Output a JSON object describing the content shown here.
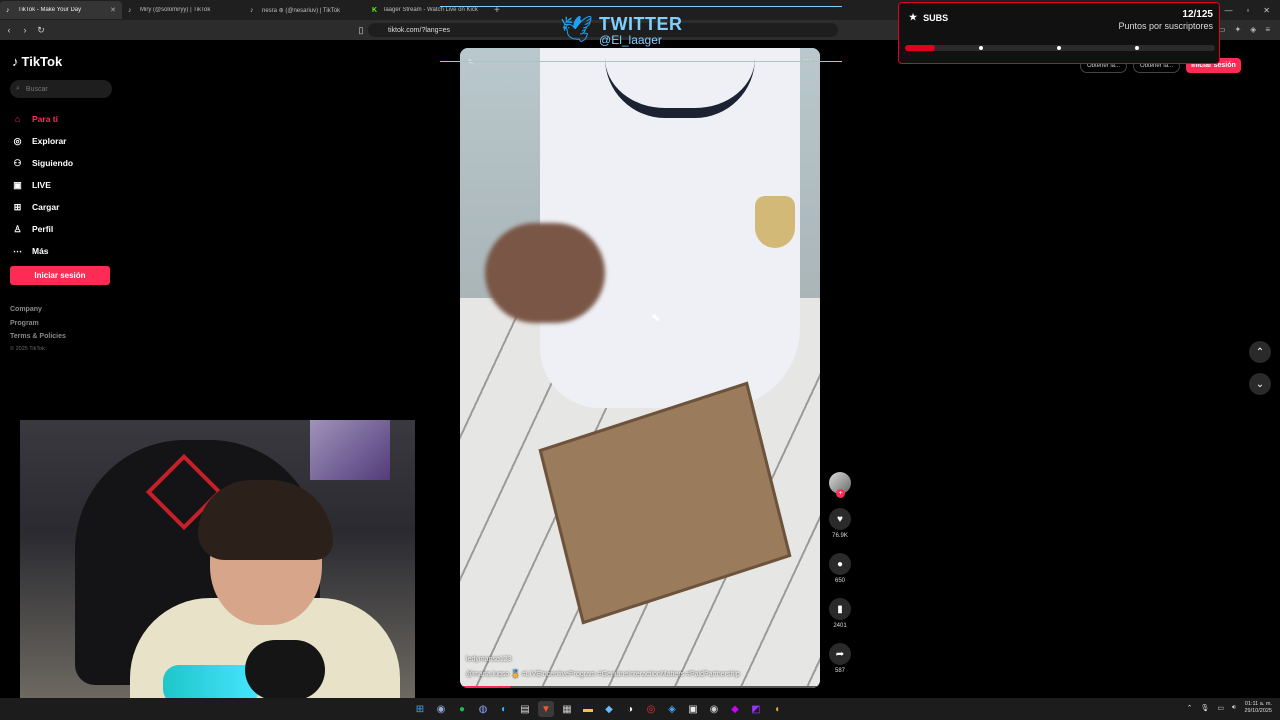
{
  "browser": {
    "tabs": [
      {
        "label": "TikTok - Make Your Day",
        "icon": "tiktok-icon",
        "active": true
      },
      {
        "label": "Miry (@solomiryy) | TikTok",
        "icon": "tiktok-icon",
        "active": false
      },
      {
        "label": "nesra ⊛ (@nesariuv) | TikTok",
        "icon": "tiktok-icon",
        "active": false
      },
      {
        "label": "laager Stream - Watch Live on Kick",
        "icon": "kick-icon",
        "active": false
      }
    ],
    "url": "tiktok.com/?lang=es"
  },
  "sidebar": {
    "logo": "TikTok",
    "search_placeholder": "Buscar",
    "items": [
      {
        "label": "Para ti",
        "icon": "home-icon",
        "active": true
      },
      {
        "label": "Explorar",
        "icon": "compass-icon",
        "active": false
      },
      {
        "label": "Siguiendo",
        "icon": "following-icon",
        "active": false
      },
      {
        "label": "LIVE",
        "icon": "live-icon",
        "active": false
      },
      {
        "label": "Cargar",
        "icon": "upload-icon",
        "active": false
      },
      {
        "label": "Perfil",
        "icon": "profile-icon",
        "active": false
      },
      {
        "label": "Más",
        "icon": "more-icon",
        "active": false
      }
    ],
    "login_label": "Iniciar sesión",
    "footer": [
      "Company",
      "Program",
      "Terms & Policies"
    ],
    "copyright": "© 2025 TikTok"
  },
  "overlay": {
    "twitter_title": "TWITTER",
    "twitter_handle": "@El_laager"
  },
  "video": {
    "author": "ledymanso123",
    "caption": "@maria.luqso 🏅 #LIVEIncentiveProgram #GenuineInteractionMatters #PaidPartnership",
    "progress": 0.14
  },
  "actions": {
    "likes": "76.9K",
    "comments": "650",
    "saves": "2401",
    "shares": "587"
  },
  "topright": {
    "btn1": "Obtener la...",
    "btn2": "Obtener la...",
    "login": "Iniciar sesión"
  },
  "subs": {
    "title": "SUBS",
    "count": "12/125",
    "subtitle": "Puntos por suscriptores",
    "progress": 0.096
  },
  "taskbar": {
    "time": "01:11 a. m.",
    "date": "29/10/2025"
  },
  "colors": {
    "accent": "#fe2c55",
    "subs_red": "#e1001e",
    "twitter_blue": "#7fd0ff"
  }
}
